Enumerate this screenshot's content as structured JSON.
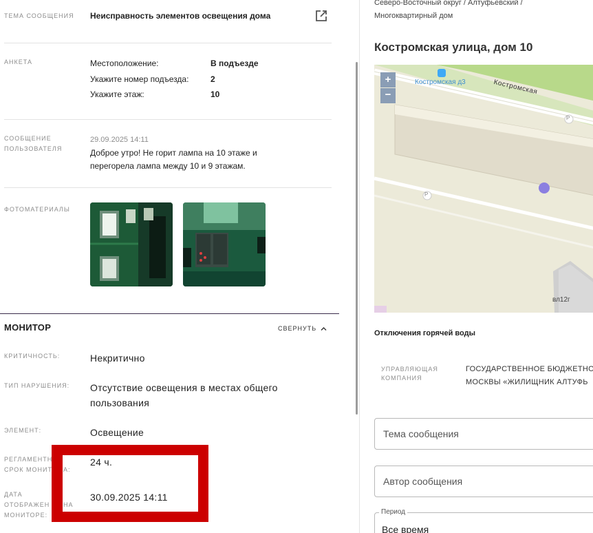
{
  "left": {
    "topic": {
      "label": "Тема сообщения",
      "value": "Неисправность элементов освещения дома"
    },
    "survey": {
      "label": "Анкета",
      "rows": [
        {
          "q": "Местоположение:",
          "a": "В подъезде"
        },
        {
          "q": "Укажите номер подъезда:",
          "a": "2"
        },
        {
          "q": "Укажите этаж:",
          "a": "10"
        }
      ]
    },
    "user_message": {
      "label_line1": "Сообщение",
      "label_line2": "пользователя",
      "timestamp": "29.09.2025 14:11",
      "text_line1": "Доброе утро! Не горит лампа на 10 этаже и",
      "text_line2": "перегорела лампа между 10 и 9 этажам."
    },
    "photos_label": "Фотоматериалы"
  },
  "monitor": {
    "title": "МОНИТОР",
    "collapse_label": "СВЕРНУТЬ",
    "criticality": {
      "label": "Критичность:",
      "value": "Некритично"
    },
    "violation_type": {
      "label": "Тип нарушения:",
      "value_line1": "Отсутствие освещения в местах общего",
      "value_line2": "пользования"
    },
    "element": {
      "label": "Элемент:",
      "value": "Освещение"
    },
    "deadline": {
      "label_line1": "Регламентн",
      "label_line2": "срок монит",
      "label_line2_tail": "а:",
      "value": "24 ч."
    },
    "display_date": {
      "label_line1": "Дата",
      "label_line2": "отображен",
      "label_line2_tail": "на",
      "label_line3": "мониторе:",
      "value": "30.09.2025 14:11"
    }
  },
  "right": {
    "breadcrumb_line1": "Северо-Восточный округ / Алтуфьевский /",
    "breadcrumb_line2": "Многоквартирный дом",
    "address": "Костромская улица, дом 10",
    "map": {
      "zoom_in": "+",
      "zoom_out": "−",
      "stop_label": "Костромская д3",
      "street_label": "Костромская",
      "building_label": "вл12г",
      "parking": "P"
    },
    "hot_water": "Отключения горячей воды",
    "company": {
      "label_line1": "Управляющая",
      "label_line2": "компания",
      "value_line1": "ГОСУДАРСТВЕННОЕ БЮДЖЕТНО",
      "value_line2": "МОСКВЫ «ЖИЛИЩНИК АЛТУФЬ"
    },
    "filters": {
      "topic_placeholder": "Тема сообщения",
      "author_placeholder": "Автор сообщения",
      "period_label": "Период",
      "period_value": "Все время"
    }
  },
  "colors": {
    "highlight_red": "#cc0000",
    "map_green": "#b8d98a",
    "map_bg": "#ecead9",
    "marker": "#8b7fe0"
  }
}
